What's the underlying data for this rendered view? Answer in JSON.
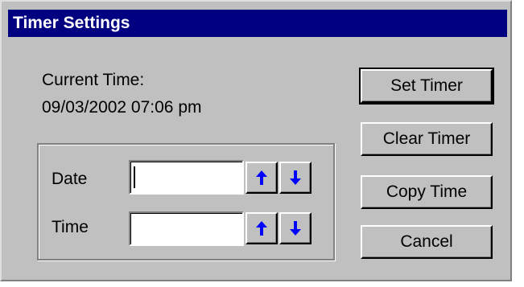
{
  "window": {
    "title": "Timer Settings"
  },
  "current_time": {
    "label": "Current Time:",
    "value": "09/03/2002 07:06 pm"
  },
  "fields": {
    "date": {
      "label": "Date",
      "value": ""
    },
    "time": {
      "label": "Time",
      "value": ""
    }
  },
  "spinners": {
    "up_icon": "up-arrow-icon",
    "down_icon": "down-arrow-icon",
    "arrow_color": "#0000ff"
  },
  "buttons": {
    "set_timer": "Set Timer",
    "clear_timer": "Clear Timer",
    "copy_time": "Copy Time",
    "cancel": "Cancel"
  },
  "colors": {
    "title_bar": "#000080",
    "face": "#c0c0c0"
  }
}
